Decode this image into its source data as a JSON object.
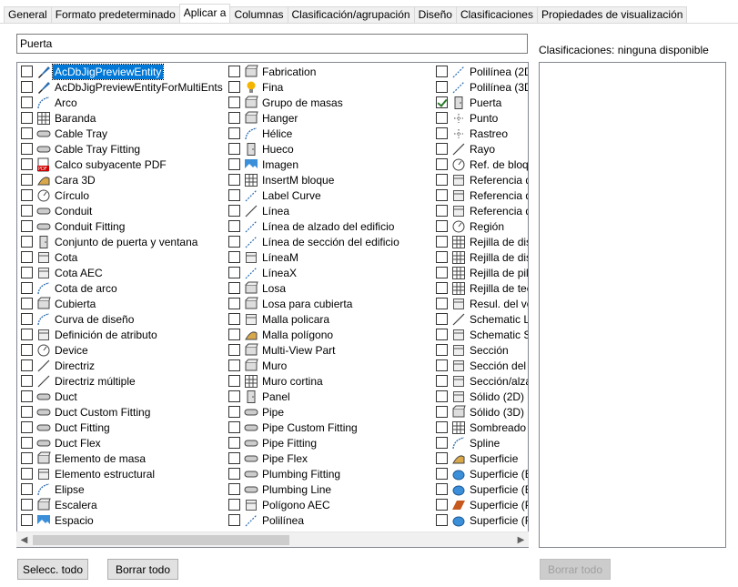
{
  "tabs": [
    "General",
    "Formato predeterminado",
    "Aplicar a",
    "Columnas",
    "Clasificación/agrupación",
    "Diseño",
    "Clasificaciones",
    "Propiedades de visualización"
  ],
  "active_tab": "Aplicar a",
  "filter": {
    "value": "Puerta"
  },
  "classifications": {
    "label": "Clasificaciones: ninguna disponible"
  },
  "buttons": {
    "select_all": "Selecc. todo",
    "clear_all": "Borrar todo",
    "clear_all_right": "Borrar todo"
  },
  "columns": [
    [
      {
        "label": "AcDbJigPreviewEntity",
        "icon": "brush-icon",
        "checked": false,
        "selected": true
      },
      {
        "label": "AcDbJigPreviewEntityForMultiEnts",
        "icon": "brush-icon",
        "checked": false
      },
      {
        "label": "Arco",
        "icon": "arc-icon",
        "checked": false
      },
      {
        "label": "Baranda",
        "icon": "railing-icon",
        "checked": false
      },
      {
        "label": "Cable Tray",
        "icon": "cable-tray-icon",
        "checked": false
      },
      {
        "label": "Cable Tray Fitting",
        "icon": "cable-tray-fitting-icon",
        "checked": false
      },
      {
        "label": "Calco subyacente PDF",
        "icon": "pdf-icon",
        "checked": false
      },
      {
        "label": "Cara 3D",
        "icon": "face-3d-icon",
        "checked": false
      },
      {
        "label": "Círculo",
        "icon": "circle-icon",
        "checked": false
      },
      {
        "label": "Conduit",
        "icon": "conduit-icon",
        "checked": false
      },
      {
        "label": "Conduit Fitting",
        "icon": "conduit-fitting-icon",
        "checked": false
      },
      {
        "label": "Conjunto de puerta y ventana",
        "icon": "door-window-assembly-icon",
        "checked": false
      },
      {
        "label": "Cota",
        "icon": "dimension-icon",
        "checked": false
      },
      {
        "label": "Cota AEC",
        "icon": "aec-dimension-icon",
        "checked": false
      },
      {
        "label": "Cota de arco",
        "icon": "arc-dimension-icon",
        "checked": false
      },
      {
        "label": "Cubierta",
        "icon": "roof-icon",
        "checked": false
      },
      {
        "label": "Curva de diseño",
        "icon": "design-curve-icon",
        "checked": false
      },
      {
        "label": "Definición de atributo",
        "icon": "attribute-definition-icon",
        "checked": false
      },
      {
        "label": "Device",
        "icon": "device-icon",
        "checked": false
      },
      {
        "label": "Directriz",
        "icon": "leader-icon",
        "checked": false
      },
      {
        "label": "Directriz múltiple",
        "icon": "multileader-icon",
        "checked": false
      },
      {
        "label": "Duct",
        "icon": "duct-icon",
        "checked": false
      },
      {
        "label": "Duct Custom Fitting",
        "icon": "duct-custom-fitting-icon",
        "checked": false
      },
      {
        "label": "Duct Fitting",
        "icon": "duct-fitting-icon",
        "checked": false
      },
      {
        "label": "Duct Flex",
        "icon": "duct-flex-icon",
        "checked": false
      },
      {
        "label": "Elemento de masa",
        "icon": "mass-element-icon",
        "checked": false
      },
      {
        "label": "Elemento estructural",
        "icon": "structural-member-icon",
        "checked": false
      },
      {
        "label": "Elipse",
        "icon": "ellipse-icon",
        "checked": false
      },
      {
        "label": "Escalera",
        "icon": "stair-icon",
        "checked": false
      },
      {
        "label": "Espacio",
        "icon": "space-icon",
        "checked": false
      }
    ],
    [
      {
        "label": "Fabrication",
        "icon": "fabrication-icon",
        "checked": false
      },
      {
        "label": "Fina",
        "icon": "bulb-icon",
        "checked": false
      },
      {
        "label": "Grupo de masas",
        "icon": "mass-group-icon",
        "checked": false
      },
      {
        "label": "Hanger",
        "icon": "hanger-icon",
        "checked": false
      },
      {
        "label": "Hélice",
        "icon": "helix-icon",
        "checked": false
      },
      {
        "label": "Hueco",
        "icon": "opening-icon",
        "checked": false
      },
      {
        "label": "Imagen",
        "icon": "image-icon",
        "checked": false
      },
      {
        "label": "InsertM bloque",
        "icon": "minsert-block-icon",
        "checked": false
      },
      {
        "label": "Label Curve",
        "icon": "label-curve-icon",
        "checked": false
      },
      {
        "label": "Línea",
        "icon": "line-icon",
        "checked": false
      },
      {
        "label": "Línea de alzado del edificio",
        "icon": "elevation-line-icon",
        "checked": false
      },
      {
        "label": "Línea de sección del edificio",
        "icon": "section-line-icon",
        "checked": false
      },
      {
        "label": "LíneaM",
        "icon": "mline-icon",
        "checked": false
      },
      {
        "label": "LíneaX",
        "icon": "xline-icon",
        "checked": false
      },
      {
        "label": "Losa",
        "icon": "slab-icon",
        "checked": false
      },
      {
        "label": "Losa para cubierta",
        "icon": "roof-slab-icon",
        "checked": false
      },
      {
        "label": "Malla policara",
        "icon": "polyface-mesh-icon",
        "checked": false
      },
      {
        "label": "Malla polígono",
        "icon": "polygon-mesh-icon",
        "checked": false
      },
      {
        "label": "Multi-View Part",
        "icon": "multi-view-part-icon",
        "checked": false
      },
      {
        "label": "Muro",
        "icon": "wall-icon",
        "checked": false
      },
      {
        "label": "Muro cortina",
        "icon": "curtain-wall-icon",
        "checked": false
      },
      {
        "label": "Panel",
        "icon": "panel-icon",
        "checked": false
      },
      {
        "label": "Pipe",
        "icon": "pipe-icon",
        "checked": false
      },
      {
        "label": "Pipe Custom Fitting",
        "icon": "pipe-custom-fitting-icon",
        "checked": false
      },
      {
        "label": "Pipe Fitting",
        "icon": "pipe-fitting-icon",
        "checked": false
      },
      {
        "label": "Pipe Flex",
        "icon": "pipe-flex-icon",
        "checked": false
      },
      {
        "label": "Plumbing Fitting",
        "icon": "plumbing-fitting-icon",
        "checked": false
      },
      {
        "label": "Plumbing Line",
        "icon": "plumbing-line-icon",
        "checked": false
      },
      {
        "label": "Polígono AEC",
        "icon": "aec-polygon-icon",
        "checked": false
      },
      {
        "label": "Polilínea",
        "icon": "polyline-icon",
        "checked": false
      }
    ],
    [
      {
        "label": "Polilínea (2D",
        "icon": "polyline-2d-icon",
        "checked": false
      },
      {
        "label": "Polilínea (3D",
        "icon": "polyline-3d-icon",
        "checked": false
      },
      {
        "label": "Puerta",
        "icon": "door-icon",
        "checked": true
      },
      {
        "label": "Punto",
        "icon": "point-icon",
        "checked": false
      },
      {
        "label": "Rastreo",
        "icon": "trace-icon",
        "checked": false
      },
      {
        "label": "Rayo",
        "icon": "ray-icon",
        "checked": false
      },
      {
        "label": "Ref. de bloqu",
        "icon": "block-ref-icon",
        "checked": false
      },
      {
        "label": "Referencia d",
        "icon": "reference-icon",
        "checked": false
      },
      {
        "label": "Referencia d",
        "icon": "reference-icon",
        "checked": false
      },
      {
        "label": "Referencia d",
        "icon": "reference-icon",
        "checked": false
      },
      {
        "label": "Región",
        "icon": "region-icon",
        "checked": false
      },
      {
        "label": "Rejilla de dis",
        "icon": "layout-grid-icon",
        "checked": false
      },
      {
        "label": "Rejilla de dis",
        "icon": "layout-grid-3d-icon",
        "checked": false
      },
      {
        "label": "Rejilla de pila",
        "icon": "column-grid-icon",
        "checked": false
      },
      {
        "label": "Rejilla de tec",
        "icon": "ceiling-grid-icon",
        "checked": false
      },
      {
        "label": "Resul. del vo",
        "icon": "volume-result-icon",
        "checked": false
      },
      {
        "label": "Schematic Li",
        "icon": "schematic-line-icon",
        "checked": false
      },
      {
        "label": "Schematic Sy",
        "icon": "schematic-symbol-icon",
        "checked": false
      },
      {
        "label": "Sección",
        "icon": "section-icon",
        "checked": false
      },
      {
        "label": "Sección del e",
        "icon": "building-section-icon",
        "checked": false
      },
      {
        "label": "Sección/alza",
        "icon": "section-elevation-icon",
        "checked": false
      },
      {
        "label": "Sólido (2D)",
        "icon": "solid-2d-icon",
        "checked": false
      },
      {
        "label": "Sólido (3D)",
        "icon": "solid-3d-icon",
        "checked": false
      },
      {
        "label": "Sombreado",
        "icon": "hatch-icon",
        "checked": false
      },
      {
        "label": "Spline",
        "icon": "spline-icon",
        "checked": false
      },
      {
        "label": "Superficie",
        "icon": "surface-icon",
        "checked": false
      },
      {
        "label": "Superficie (B",
        "icon": "surface-b-icon",
        "checked": false
      },
      {
        "label": "Superficie (E",
        "icon": "surface-e-icon",
        "checked": false
      },
      {
        "label": "Superficie (P",
        "icon": "surface-p-icon",
        "checked": false
      },
      {
        "label": "Superficie (R",
        "icon": "surface-r-icon",
        "checked": false
      }
    ]
  ]
}
